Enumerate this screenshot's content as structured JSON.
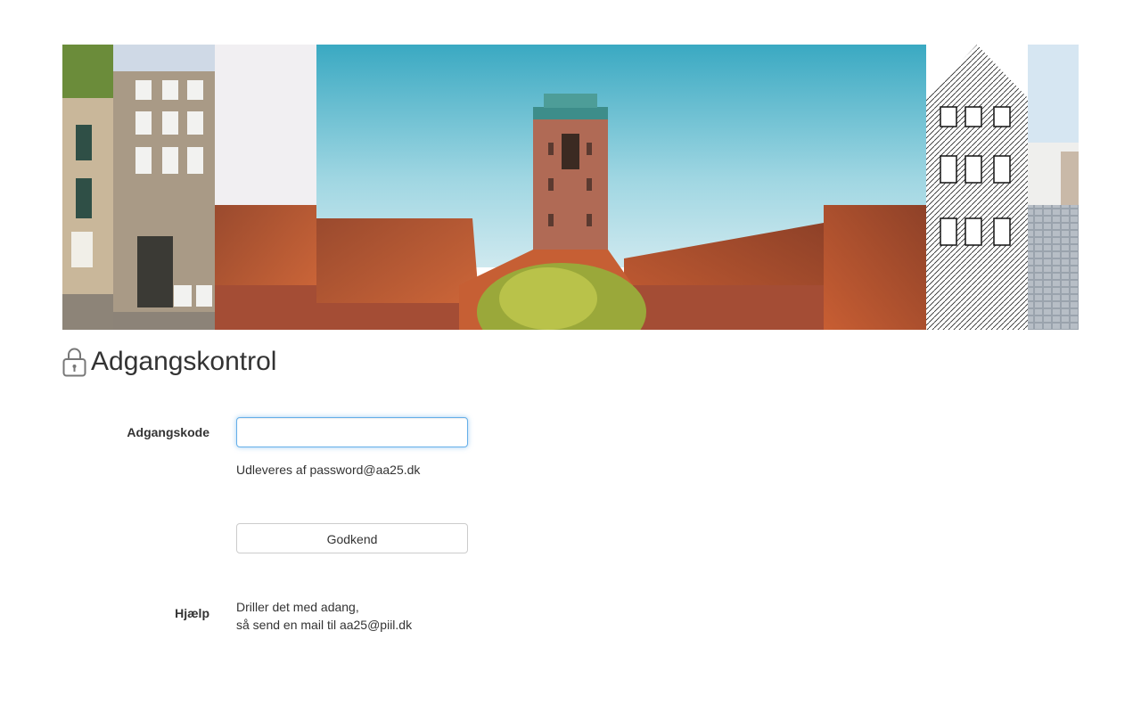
{
  "page": {
    "title": "Adgangskontrol",
    "title_icon": "lock-icon"
  },
  "form": {
    "password_label": "Adgangskode",
    "password_value": "",
    "password_hint": "Udleveres af password@aa25.dk",
    "submit_label": "Godkend"
  },
  "help": {
    "label": "Hjælp",
    "line1": "Driller det med adang,",
    "line2": "så send en mail til aa25@piil.dk"
  },
  "colors": {
    "focus_border": "#66afe9",
    "text": "#333333",
    "button_border": "#cccccc"
  }
}
